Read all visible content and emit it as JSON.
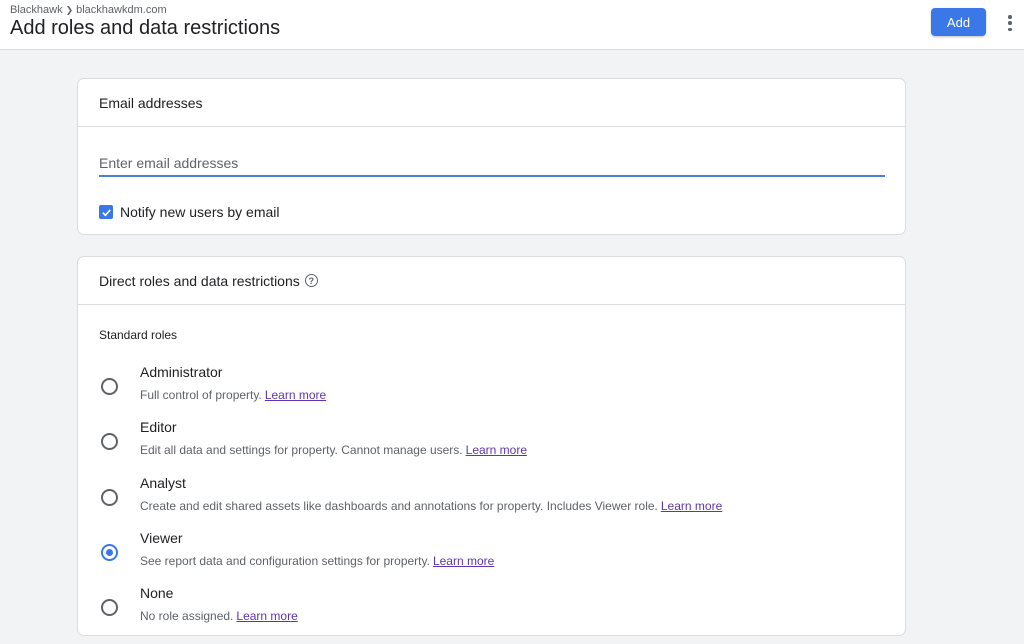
{
  "header": {
    "breadcrumb": [
      "Blackhawk",
      "blackhawkdm.com"
    ],
    "title": "Add roles and data restrictions",
    "add_label": "Add"
  },
  "email_card": {
    "title": "Email addresses",
    "input_placeholder": "Enter email addresses",
    "input_value": "",
    "notify_label": "Notify new users by email",
    "notify_checked": true
  },
  "roles_card": {
    "title": "Direct roles and data restrictions",
    "section_label": "Standard roles",
    "learn_more": "Learn more",
    "selected": "Viewer",
    "roles": [
      {
        "name": "Administrator",
        "description": "Full control of property."
      },
      {
        "name": "Editor",
        "description": "Edit all data and settings for property. Cannot manage users."
      },
      {
        "name": "Analyst",
        "description": "Create and edit shared assets like dashboards and annotations for property. Includes Viewer role."
      },
      {
        "name": "Viewer",
        "description": "See report data and configuration settings for property."
      },
      {
        "name": "None",
        "description": "No role assigned."
      }
    ]
  },
  "colors": {
    "accent": "#3b78e7",
    "link": "#5e35b1",
    "background": "#f1f3f4"
  },
  "icons": {
    "breadcrumb_separator": "chevron-right-icon",
    "menu": "more-vert-icon",
    "help": "help-circle-icon",
    "checkbox": "check-icon"
  }
}
